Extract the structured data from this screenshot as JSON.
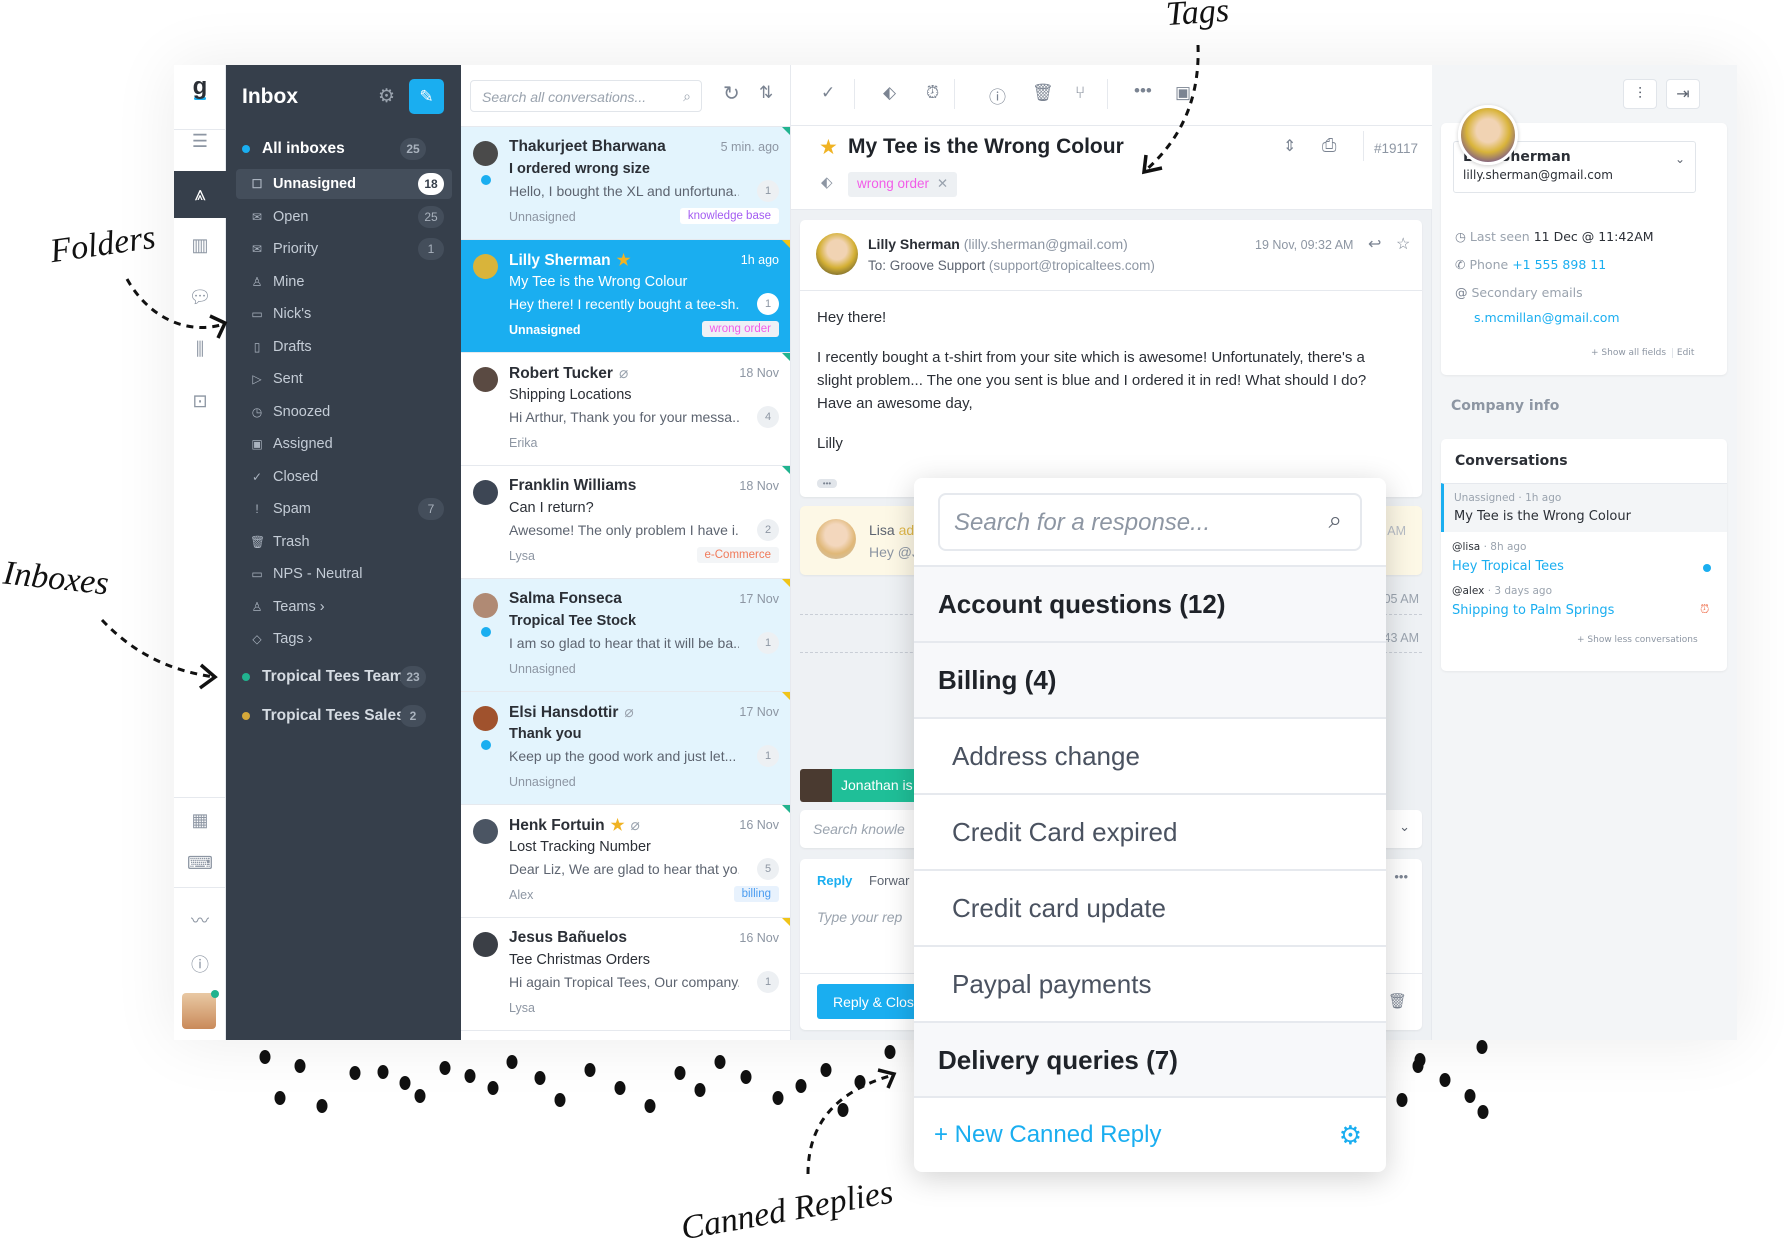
{
  "annotations": {
    "tags": "Tags",
    "folders": "Folders",
    "inboxes": "Inboxes",
    "canned": "Canned Replies"
  },
  "rail": {
    "icons": [
      "groove-logo-icon",
      "menu-icon",
      "inbox-nav-icon",
      "knowledge-base-icon",
      "chat-icon",
      "reports-icon",
      "bot-icon",
      "layout-icon",
      "keyboard-icon",
      "activity-icon",
      "help-icon",
      "user-avatar"
    ]
  },
  "sidebar": {
    "title": "Inbox",
    "all_inboxes": {
      "label": "All inboxes",
      "count": "25"
    },
    "folders": [
      {
        "label": "Unnasigned",
        "count": "18",
        "icon": "☐"
      },
      {
        "label": "Open",
        "count": "25",
        "icon": "✉"
      },
      {
        "label": "Priority",
        "count": "1",
        "icon": "✉"
      },
      {
        "label": "Mine",
        "count": "",
        "icon": "♙"
      },
      {
        "label": "Nick's",
        "count": "",
        "icon": "▭"
      },
      {
        "label": "Drafts",
        "count": "",
        "icon": "▯"
      },
      {
        "label": "Sent",
        "count": "",
        "icon": "▷"
      },
      {
        "label": "Snoozed",
        "count": "",
        "icon": "◷"
      },
      {
        "label": "Assigned",
        "count": "",
        "icon": "▣"
      },
      {
        "label": "Closed",
        "count": "",
        "icon": "✓"
      },
      {
        "label": "Spam",
        "count": "7",
        "icon": "!"
      },
      {
        "label": "Trash",
        "count": "",
        "icon": "🗑"
      },
      {
        "label": "NPS - Neutral",
        "count": "",
        "icon": "▭"
      },
      {
        "label": "Teams ›",
        "count": "",
        "icon": "♙"
      },
      {
        "label": "Tags ›",
        "count": "",
        "icon": "◇"
      }
    ],
    "inboxes": [
      {
        "label": "Tropical Tees Team",
        "count": "23",
        "color": "#21b38f"
      },
      {
        "label": "Tropical Tees Sales",
        "count": "2",
        "color": "#d4a83a"
      }
    ]
  },
  "list": {
    "search_placeholder": "Search all conversations...",
    "conversations": [
      {
        "name": "Thakurjeet Bharwana",
        "time": "5 min. ago",
        "subject": "I ordered wrong size",
        "preview": "Hello, I bought the XL and unfortuna...",
        "count": "1",
        "footer": "Unnasigned",
        "tag": "knowledge base",
        "tag_color": "#a35cf2",
        "star": false,
        "clip": false,
        "unread": true,
        "state": "unr",
        "corner": "#21b38f",
        "avatar": "#4a4a4a"
      },
      {
        "name": "Lilly Sherman",
        "time": "1h ago",
        "subject": "My Tee is the Wrong Colour",
        "preview": "Hey there! I recently bought a tee-sh...",
        "count": "1",
        "footer": "Unnasigned",
        "tag": "wrong order",
        "tag_color": "#f25ce8",
        "star": true,
        "clip": false,
        "unread": false,
        "state": "sel",
        "corner": "#f0c419",
        "avatar": "#d9b43a"
      },
      {
        "name": "Robert Tucker",
        "time": "18 Nov",
        "subject": "Shipping Locations",
        "preview": "Hi Arthur, Thank you for your messa...",
        "count": "4",
        "footer": "Erika",
        "tag": "",
        "tag_color": "",
        "star": false,
        "clip": true,
        "unread": false,
        "state": "",
        "corner": "#21b38f",
        "avatar": "#5a4a42"
      },
      {
        "name": "Franklin Williams",
        "time": "18 Nov",
        "subject": "Can I return?",
        "preview": "Awesome! The only problem I have i...",
        "count": "2",
        "footer": "Lysa",
        "tag": "e-Commerce",
        "tag_color": "#f07a5a",
        "star": false,
        "clip": false,
        "unread": false,
        "state": "",
        "corner": "#21b38f",
        "avatar": "#3d4654"
      },
      {
        "name": "Salma Fonseca",
        "time": "17 Nov",
        "subject": "Tropical Tee Stock",
        "preview": "I am so glad to hear that it will be ba...",
        "count": "1",
        "footer": "Unnasigned",
        "tag": "",
        "tag_color": "",
        "star": false,
        "clip": false,
        "unread": true,
        "state": "unr",
        "corner": "#f0c419",
        "avatar": "#b08a74"
      },
      {
        "name": "Elsi Hansdottir",
        "time": "17 Nov",
        "subject": "Thank you",
        "preview": "Keep up the good work and just let...",
        "count": "1",
        "footer": "Unnasigned",
        "tag": "",
        "tag_color": "",
        "star": false,
        "clip": true,
        "unread": true,
        "state": "unr",
        "corner": "#f0c419",
        "avatar": "#a0522d"
      },
      {
        "name": "Henk Fortuin",
        "time": "16 Nov",
        "subject": "Lost Tracking Number",
        "preview": "Dear Liz, We are glad to hear that yo...",
        "count": "5",
        "footer": "Alex",
        "tag": "billing",
        "tag_color": "#4a9cf0",
        "star": true,
        "clip": true,
        "unread": false,
        "state": "",
        "corner": "#21b38f",
        "avatar": "#4b5563"
      },
      {
        "name": "Jesus Bañuelos",
        "time": "16 Nov",
        "subject": "Tee Christmas Orders",
        "preview": "Hi again Tropical Tees, Our company...",
        "count": "1",
        "footer": "Lysa",
        "tag": "",
        "tag_color": "",
        "star": false,
        "clip": false,
        "unread": false,
        "state": "",
        "corner": "#f0c419",
        "avatar": "#3b3f46"
      }
    ]
  },
  "main": {
    "toolbar": [
      "check-icon",
      "tag-icon",
      "snooze-icon",
      "spam-icon",
      "trash-icon",
      "merge-icon",
      "more-icon",
      "assign-icon"
    ],
    "title": "My Tee is the Wrong Colour",
    "ticket": "#19117",
    "tag": "wrong order",
    "message": {
      "sender": "Lilly Sherman",
      "sender_email": "(lilly.sherman@gmail.com)",
      "to_label": "To: Groove Support",
      "to_email": "(support@tropicaltees.com)",
      "time": "19 Nov, 09:32 AM",
      "body": [
        "Hey there!",
        "I recently bought a t-shirt from your site which is awesome! Unfortunately, there's a",
        "slight problem... The one you sent is blue and I ordered it in red! What should I do?",
        "Have an awesome day,",
        "Lilly"
      ],
      "more": "•••"
    },
    "note": {
      "author": "Lisa",
      "action": "ad",
      "text": "Hey @J",
      "time": "AM"
    },
    "events": [
      "05 AM",
      "43 AM"
    ],
    "typing": "Jonathan is",
    "kb_placeholder": "Search knowle",
    "composer": {
      "reply_tab": "Reply",
      "forward_tab": "Forwar",
      "placeholder": "Type your rep",
      "send": "Reply & Clos",
      "more": "•••"
    }
  },
  "right": {
    "name": "Lilly Sherman",
    "email": "lilly.sherman@gmail.com",
    "last_seen_label": "Last seen",
    "last_seen": "11 Dec @ 11:42AM",
    "phone_label": "Phone",
    "phone": "+1 555 898 11",
    "secondary_label": "Secondary emails",
    "secondary": "s.mcmillan@gmail.com",
    "show_all": "+ Show all fields",
    "edit": "Edit",
    "company": "Company info",
    "conv_title": "Conversations",
    "conversations": [
      {
        "meta": "Unassigned",
        "time": "· 1h ago",
        "title": "My Tee is the Wrong Colour"
      },
      {
        "meta": "@lisa",
        "time": "· 8h ago",
        "title": "Hey Tropical Tees"
      },
      {
        "meta": "@alex",
        "time": "· 3 days ago",
        "title": "Shipping to Palm Springs"
      }
    ],
    "show_less": "+ Show less conversations"
  },
  "canned": {
    "search_placeholder": "Search for a response...",
    "items": [
      {
        "label": "Account questions (12)",
        "type": "h"
      },
      {
        "label": "Billing (4)",
        "type": "h"
      },
      {
        "label": "Address change",
        "type": "s"
      },
      {
        "label": "Credit Card expired",
        "type": "s"
      },
      {
        "label": "Credit card update",
        "type": "s"
      },
      {
        "label": "Paypal payments",
        "type": "s"
      },
      {
        "label": "Delivery queries (7)",
        "type": "h"
      }
    ],
    "new_label": "+ New Canned Reply"
  },
  "colors": {
    "accent": "#1aaef0",
    "sidebar": "#363f4b",
    "green": "#21b38f"
  }
}
